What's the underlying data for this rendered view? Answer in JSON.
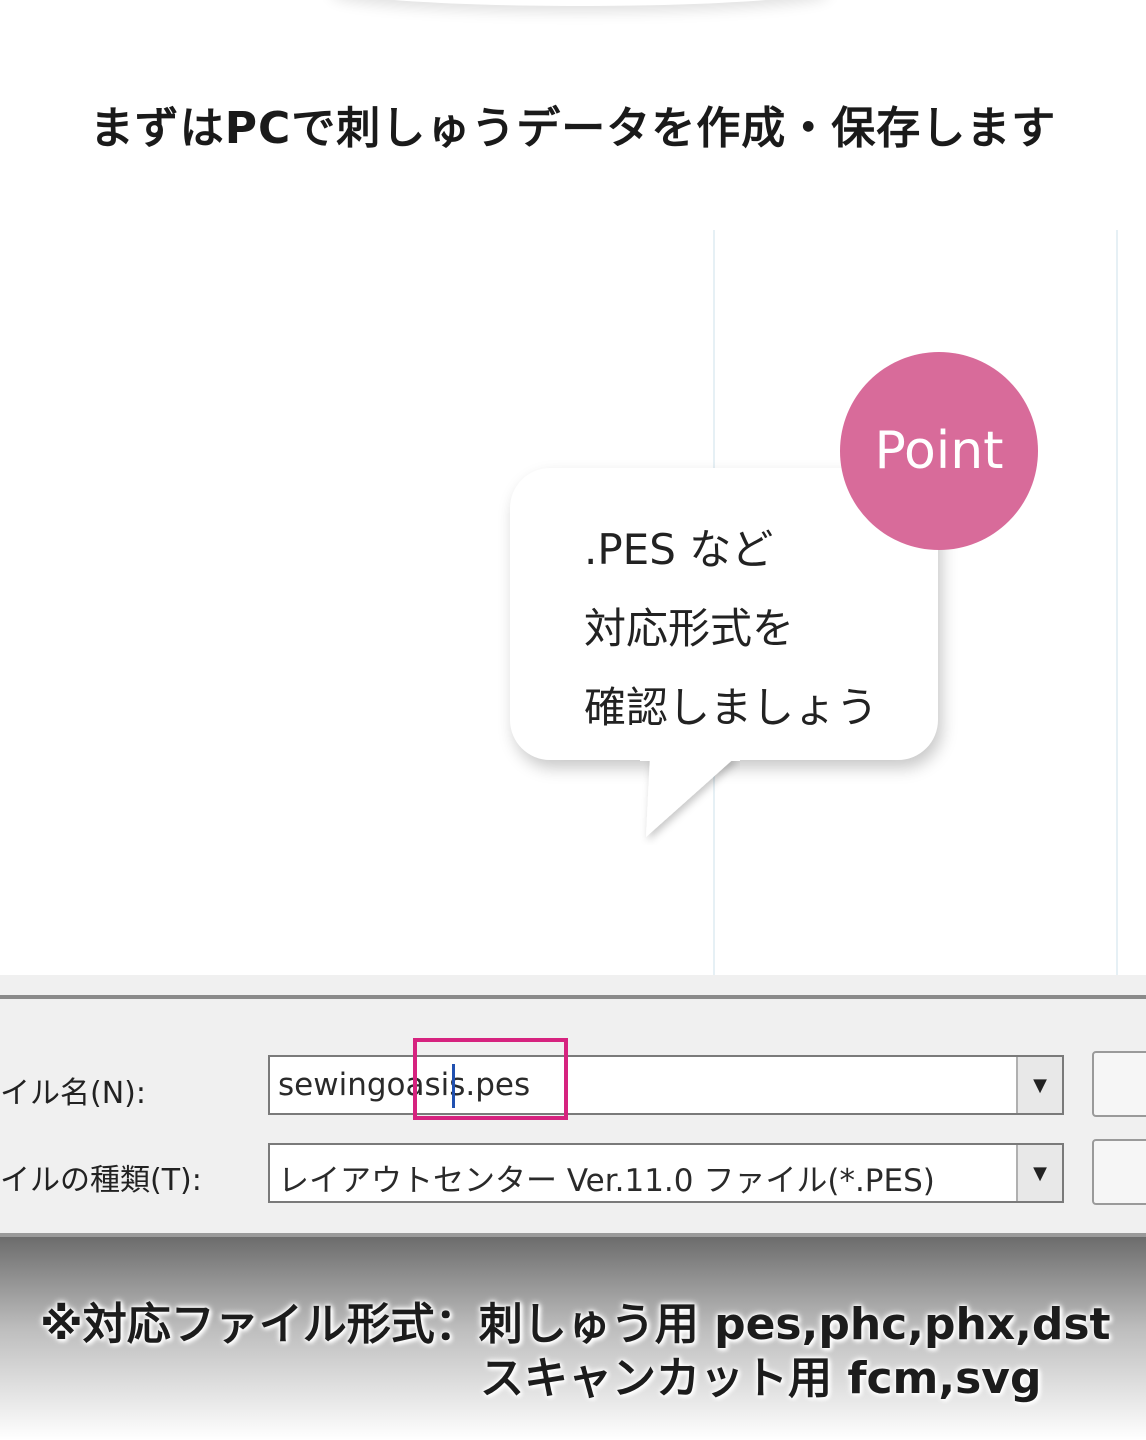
{
  "headline": "まずはPCで刺しゅうデータを作成・保存します",
  "callout": {
    "badge": "Point",
    "lines": [
      ".PES など",
      "対応形式を",
      "確認しましょう"
    ]
  },
  "dialog": {
    "filename_label": "イル名(N):",
    "filename_value": "sewingoasis.pes",
    "filetype_label": "イルの種類(T):",
    "filetype_value": "レイアウトセンター Ver.11.0 ファイル(*.PES)",
    "dropdown_icon": "▼"
  },
  "note": {
    "line1": "※対応ファイル形式：刺しゅう用 pes,phc,phx,dst",
    "line2": "スキャンカット用 fcm,svg"
  },
  "colors": {
    "badge": "#d86b9a",
    "highlight": "#d6237f"
  }
}
